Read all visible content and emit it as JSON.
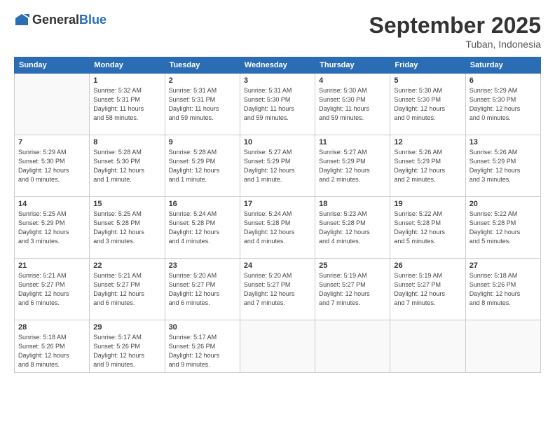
{
  "header": {
    "logo_line1": "General",
    "logo_line2": "Blue",
    "month": "September 2025",
    "location": "Tuban, Indonesia"
  },
  "days_of_week": [
    "Sunday",
    "Monday",
    "Tuesday",
    "Wednesday",
    "Thursday",
    "Friday",
    "Saturday"
  ],
  "weeks": [
    [
      {
        "num": "",
        "info": ""
      },
      {
        "num": "1",
        "info": "Sunrise: 5:32 AM\nSunset: 5:31 PM\nDaylight: 11 hours\nand 58 minutes."
      },
      {
        "num": "2",
        "info": "Sunrise: 5:31 AM\nSunset: 5:31 PM\nDaylight: 11 hours\nand 59 minutes."
      },
      {
        "num": "3",
        "info": "Sunrise: 5:31 AM\nSunset: 5:30 PM\nDaylight: 11 hours\nand 59 minutes."
      },
      {
        "num": "4",
        "info": "Sunrise: 5:30 AM\nSunset: 5:30 PM\nDaylight: 11 hours\nand 59 minutes."
      },
      {
        "num": "5",
        "info": "Sunrise: 5:30 AM\nSunset: 5:30 PM\nDaylight: 12 hours\nand 0 minutes."
      },
      {
        "num": "6",
        "info": "Sunrise: 5:29 AM\nSunset: 5:30 PM\nDaylight: 12 hours\nand 0 minutes."
      }
    ],
    [
      {
        "num": "7",
        "info": "Sunrise: 5:29 AM\nSunset: 5:30 PM\nDaylight: 12 hours\nand 0 minutes."
      },
      {
        "num": "8",
        "info": "Sunrise: 5:28 AM\nSunset: 5:30 PM\nDaylight: 12 hours\nand 1 minute."
      },
      {
        "num": "9",
        "info": "Sunrise: 5:28 AM\nSunset: 5:29 PM\nDaylight: 12 hours\nand 1 minute."
      },
      {
        "num": "10",
        "info": "Sunrise: 5:27 AM\nSunset: 5:29 PM\nDaylight: 12 hours\nand 1 minute."
      },
      {
        "num": "11",
        "info": "Sunrise: 5:27 AM\nSunset: 5:29 PM\nDaylight: 12 hours\nand 2 minutes."
      },
      {
        "num": "12",
        "info": "Sunrise: 5:26 AM\nSunset: 5:29 PM\nDaylight: 12 hours\nand 2 minutes."
      },
      {
        "num": "13",
        "info": "Sunrise: 5:26 AM\nSunset: 5:29 PM\nDaylight: 12 hours\nand 3 minutes."
      }
    ],
    [
      {
        "num": "14",
        "info": "Sunrise: 5:25 AM\nSunset: 5:29 PM\nDaylight: 12 hours\nand 3 minutes."
      },
      {
        "num": "15",
        "info": "Sunrise: 5:25 AM\nSunset: 5:28 PM\nDaylight: 12 hours\nand 3 minutes."
      },
      {
        "num": "16",
        "info": "Sunrise: 5:24 AM\nSunset: 5:28 PM\nDaylight: 12 hours\nand 4 minutes."
      },
      {
        "num": "17",
        "info": "Sunrise: 5:24 AM\nSunset: 5:28 PM\nDaylight: 12 hours\nand 4 minutes."
      },
      {
        "num": "18",
        "info": "Sunrise: 5:23 AM\nSunset: 5:28 PM\nDaylight: 12 hours\nand 4 minutes."
      },
      {
        "num": "19",
        "info": "Sunrise: 5:22 AM\nSunset: 5:28 PM\nDaylight: 12 hours\nand 5 minutes."
      },
      {
        "num": "20",
        "info": "Sunrise: 5:22 AM\nSunset: 5:28 PM\nDaylight: 12 hours\nand 5 minutes."
      }
    ],
    [
      {
        "num": "21",
        "info": "Sunrise: 5:21 AM\nSunset: 5:27 PM\nDaylight: 12 hours\nand 6 minutes."
      },
      {
        "num": "22",
        "info": "Sunrise: 5:21 AM\nSunset: 5:27 PM\nDaylight: 12 hours\nand 6 minutes."
      },
      {
        "num": "23",
        "info": "Sunrise: 5:20 AM\nSunset: 5:27 PM\nDaylight: 12 hours\nand 6 minutes."
      },
      {
        "num": "24",
        "info": "Sunrise: 5:20 AM\nSunset: 5:27 PM\nDaylight: 12 hours\nand 7 minutes."
      },
      {
        "num": "25",
        "info": "Sunrise: 5:19 AM\nSunset: 5:27 PM\nDaylight: 12 hours\nand 7 minutes."
      },
      {
        "num": "26",
        "info": "Sunrise: 5:19 AM\nSunset: 5:27 PM\nDaylight: 12 hours\nand 7 minutes."
      },
      {
        "num": "27",
        "info": "Sunrise: 5:18 AM\nSunset: 5:26 PM\nDaylight: 12 hours\nand 8 minutes."
      }
    ],
    [
      {
        "num": "28",
        "info": "Sunrise: 5:18 AM\nSunset: 5:26 PM\nDaylight: 12 hours\nand 8 minutes."
      },
      {
        "num": "29",
        "info": "Sunrise: 5:17 AM\nSunset: 5:26 PM\nDaylight: 12 hours\nand 9 minutes."
      },
      {
        "num": "30",
        "info": "Sunrise: 5:17 AM\nSunset: 5:26 PM\nDaylight: 12 hours\nand 9 minutes."
      },
      {
        "num": "",
        "info": ""
      },
      {
        "num": "",
        "info": ""
      },
      {
        "num": "",
        "info": ""
      },
      {
        "num": "",
        "info": ""
      }
    ]
  ]
}
